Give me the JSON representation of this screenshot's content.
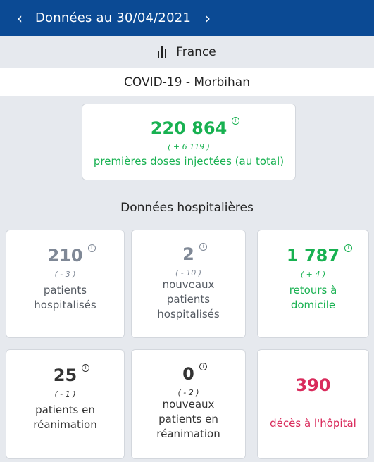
{
  "header": {
    "title": "Données au 30/04/2021",
    "prev_icon": "chevron-left-icon",
    "next_icon": "chevron-right-icon"
  },
  "scope": {
    "label": "France",
    "icon": "bar-chart-icon"
  },
  "region": {
    "title": "COVID-19 - Morbihan"
  },
  "vaccination": {
    "value": "220 864",
    "delta": "( + 6 119 )",
    "label": "premières doses injectées (au total)"
  },
  "hospital": {
    "title": "Données hospitalières",
    "cards": [
      {
        "value": "210",
        "delta": "( - 3 )",
        "label": "patients hospitalisés"
      },
      {
        "value": "2",
        "delta": "( - 10 )",
        "label": "nouveaux patients hospitalisés"
      },
      {
        "value": "1 787",
        "delta": "( + 4 )",
        "label": "retours à domicile"
      },
      {
        "value": "25",
        "delta": "( - 1 )",
        "label": "patients en réanimation"
      },
      {
        "value": "0",
        "delta": "( - 2 )",
        "label": "nouveaux patients en réanimation"
      },
      {
        "value": "390",
        "label": "décès à l'hôpital"
      }
    ]
  },
  "colors": {
    "header_bg": "#0b4a94",
    "positive": "#18b151",
    "neutral": "#7f8896",
    "death": "#d92b5c"
  }
}
